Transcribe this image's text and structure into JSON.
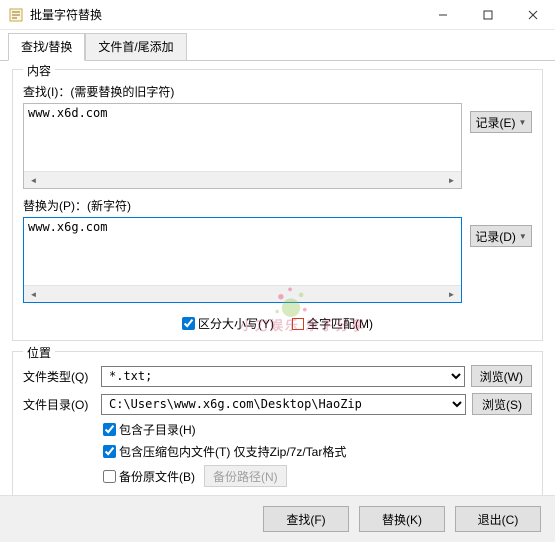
{
  "window": {
    "title": "批量字符替换"
  },
  "tabs": {
    "tab1": "查找/替换",
    "tab2": "文件首/尾添加"
  },
  "content_group": {
    "title": "内容",
    "find_label": "查找(I)：(需要替换的旧字符)",
    "find_value": "www.x6d.com",
    "record_e": "记录(E)",
    "replace_label": "替换为(P)：(新字符)",
    "replace_value": "www.x6g.com",
    "record_d": "记录(D)",
    "case_sensitive": "区分大小写(Y)",
    "whole_word": "全字匹配(M)"
  },
  "location_group": {
    "title": "位置",
    "filetype_label": "文件类型(Q)",
    "filetype_value": "*.txt;",
    "browse_w": "浏览(W)",
    "dir_label": "文件目录(O)",
    "dir_value": "C:\\Users\\www.x6g.com\\Desktop\\HaoZip",
    "browse_s": "浏览(S)",
    "include_sub": "包含子目录(H)",
    "include_archive": "包含压缩包内文件(T) 仅支持Zip/7z/Tar格式",
    "backup": "备份原文件(B)",
    "backup_path": "备份路径(N)"
  },
  "footer": {
    "find": "查找(F)",
    "replace": "替换(K)",
    "exit": "退出(C)"
  },
  "watermark": "小刀娱乐 乐子分享"
}
